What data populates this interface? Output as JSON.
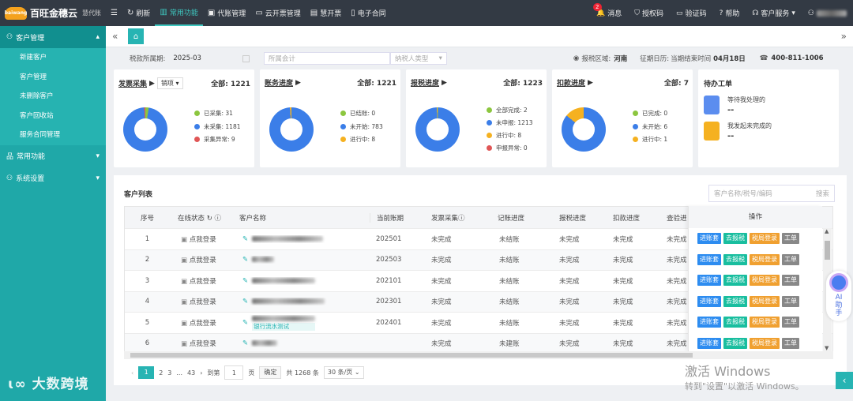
{
  "app": {
    "name": "百旺金穗云",
    "subtitle": "慧代账",
    "logo_text": "baiwang"
  },
  "nav": [
    {
      "label": "刷新",
      "icon": "refresh-icon"
    },
    {
      "label": "常用功能",
      "icon": "chart-icon",
      "active": true
    },
    {
      "label": "代账管理",
      "icon": "briefcase-icon"
    },
    {
      "label": "云开票管理",
      "icon": "ticket-icon"
    },
    {
      "label": "慧开票",
      "icon": "invoice-icon"
    },
    {
      "label": "电子合同",
      "icon": "contract-icon"
    }
  ],
  "topright": {
    "badge": "2",
    "messages": "消息",
    "auth_code": "授权码",
    "verify_code": "验证码",
    "help": "帮助",
    "service": "客户服务"
  },
  "sidebar": {
    "customer_mgmt": "客户管理",
    "items": [
      "新建客户",
      "客户管理",
      "未删除客户",
      "客户回收站",
      "服务合同管理"
    ],
    "common": "常用功能",
    "settings": "系统设置"
  },
  "watermark": "大数跨境",
  "filter": {
    "period_label": "税款所属期:",
    "period_value": "2025-03",
    "accountant_placeholder": "所属会计",
    "taxpayer_placeholder": "纳税人类型",
    "region_label": "报税区域:",
    "region_value": "河南",
    "calendar_label": "征期日历:",
    "calendar_text": "当期结束时间",
    "calendar_date": "04月18日",
    "phone": "400-811-1006"
  },
  "cards": [
    {
      "title": "发票采集",
      "select": "销项",
      "total_label": "全部:",
      "total": "1221",
      "legend": [
        {
          "label": "已采集: 31",
          "color": "#8cc63f"
        },
        {
          "label": "未采集: 1181",
          "color": "#3b7ee8"
        },
        {
          "label": "采集异常: 9",
          "color": "#e05656"
        }
      ]
    },
    {
      "title": "账务进度",
      "total_label": "全部:",
      "total": "1221",
      "legend": [
        {
          "label": "已结账: 0",
          "color": "#8cc63f"
        },
        {
          "label": "未开始: 783",
          "color": "#3b7ee8"
        },
        {
          "label": "进行中: 8",
          "color": "#f5b120"
        }
      ]
    },
    {
      "title": "报税进度",
      "total_label": "全部:",
      "total": "1223",
      "legend": [
        {
          "label": "全部完成: 2",
          "color": "#8cc63f"
        },
        {
          "label": "未申报: 1213",
          "color": "#3b7ee8"
        },
        {
          "label": "进行中: 8",
          "color": "#f5b120"
        },
        {
          "label": "申报异常: 0",
          "color": "#e05656"
        }
      ]
    },
    {
      "title": "扣款进度",
      "total_label": "全部:",
      "total": "7",
      "legend": [
        {
          "label": "已完成: 0",
          "color": "#8cc63f"
        },
        {
          "label": "未开始: 6",
          "color": "#3b7ee8"
        },
        {
          "label": "进行中: 1",
          "color": "#f5b120"
        }
      ]
    }
  ],
  "todo": {
    "title": "待办工单",
    "items": [
      {
        "label": "等待我处理的",
        "value": "--"
      },
      {
        "label": "我发起未完成的",
        "value": "--"
      }
    ]
  },
  "list": {
    "title": "客户列表",
    "search_placeholder": "客户名称/税号/编码",
    "search_btn": "搜索",
    "headers": [
      "序号",
      "在线状态",
      "客户名称",
      "当前账期",
      "发票采集",
      "记账进度",
      "报税进度",
      "扣款进度",
      "查验进"
    ],
    "ops_header": "操作",
    "login_text": "点我登录",
    "rows": [
      {
        "no": "1",
        "period": "202501",
        "invoice": "未完成",
        "account": "未结账",
        "tax": "未完成",
        "deduct": "未完成",
        "check": "未完成"
      },
      {
        "no": "2",
        "period": "202503",
        "invoice": "未完成",
        "account": "未结账",
        "tax": "未完成",
        "deduct": "未完成",
        "check": "未完成"
      },
      {
        "no": "3",
        "period": "202101",
        "invoice": "未完成",
        "account": "未结账",
        "tax": "未完成",
        "deduct": "未完成",
        "check": "未完成"
      },
      {
        "no": "4",
        "period": "202301",
        "invoice": "未完成",
        "account": "未结账",
        "tax": "未完成",
        "deduct": "未完成",
        "check": "未完成"
      },
      {
        "no": "5",
        "period": "202401",
        "invoice": "未完成",
        "account": "未结账",
        "tax": "未完成",
        "deduct": "未完成",
        "check": "未完成",
        "tag": "银行流水测试"
      },
      {
        "no": "6",
        "period": "",
        "invoice": "未完成",
        "account": "未建账",
        "tax": "未完成",
        "deduct": "未完成",
        "check": "未完成"
      }
    ],
    "ops": [
      "进账套",
      "去报税",
      "税局登录",
      "工单"
    ]
  },
  "pager": {
    "pages": [
      "1",
      "2",
      "3",
      "...",
      "43"
    ],
    "goto": "到第",
    "page_input": "1",
    "page_unit": "页",
    "confirm": "确定",
    "total": "共 1268 条",
    "per_page": "30 条/页"
  },
  "ai": {
    "line1": "AI",
    "line2": "助",
    "line3": "手"
  },
  "windows": {
    "line1": "激活 Windows",
    "line2": "转到\"设置\"以激活 Windows。"
  }
}
